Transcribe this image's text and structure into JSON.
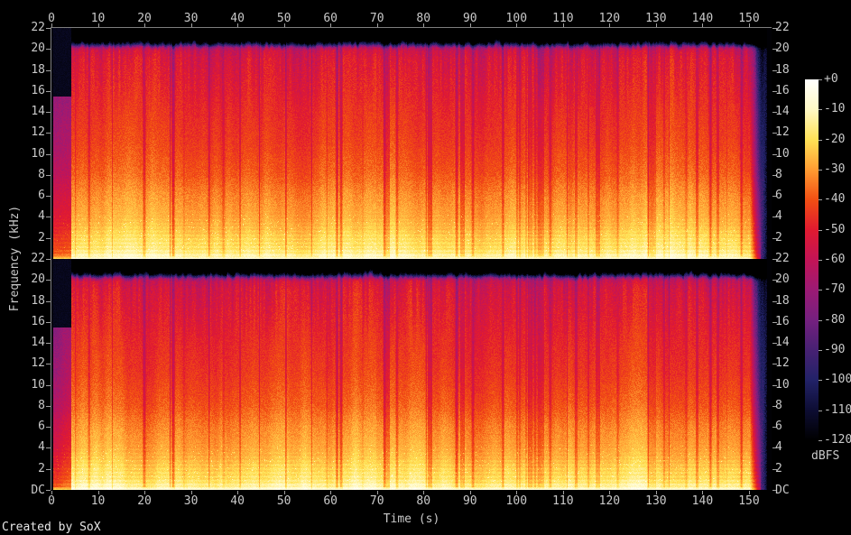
{
  "meta": {
    "credit": "Created by SoX"
  },
  "colors": {
    "background": "#000000",
    "axis_line": "#7e7e7e",
    "tick": "#a0a0a0",
    "label_text": "#c9c9c9",
    "credit_text": "#e8e8e8"
  },
  "axes": {
    "time": {
      "label": "Time (s)",
      "ticks": [
        "0",
        "10",
        "20",
        "30",
        "40",
        "50",
        "60",
        "70",
        "80",
        "90",
        "100",
        "110",
        "120",
        "130",
        "140",
        "150"
      ]
    },
    "frequency": {
      "label": "Frequency (kHz)",
      "ticks": [
        "22",
        "20",
        "18",
        "16",
        "14",
        "12",
        "10",
        "8",
        "6",
        "4",
        "2"
      ],
      "dc_label": "DC"
    }
  },
  "colorbar": {
    "label": "dBFS",
    "ticks": [
      "+0",
      "-10",
      "-20",
      "-30",
      "-40",
      "-50",
      "-60",
      "-70",
      "-80",
      "-90",
      "-100",
      "-110",
      "-120"
    ],
    "stops": [
      {
        "db": 0,
        "hex": "#ffffff"
      },
      {
        "db": -10,
        "hex": "#fff9c5"
      },
      {
        "db": -20,
        "hex": "#ffe256"
      },
      {
        "db": -30,
        "hex": "#ff9c32"
      },
      {
        "db": -40,
        "hex": "#f24f13"
      },
      {
        "db": -50,
        "hex": "#e11a30"
      },
      {
        "db": -60,
        "hex": "#c31456"
      },
      {
        "db": -70,
        "hex": "#9c1a74"
      },
      {
        "db": -80,
        "hex": "#75207f"
      },
      {
        "db": -90,
        "hex": "#472173"
      },
      {
        "db": -100,
        "hex": "#222268"
      },
      {
        "db": -110,
        "hex": "#0d0d33"
      },
      {
        "db": -120,
        "hex": "#000000"
      }
    ]
  },
  "chart_data": {
    "type": "heatmap",
    "subtype": "audio-spectrogram",
    "title": "",
    "xlabel": "Time (s)",
    "ylabel": "Frequency (kHz)",
    "zlabel": "dBFS",
    "x_range_s": [
      0,
      154.8
    ],
    "x_ticks_s": [
      0,
      10,
      20,
      30,
      40,
      50,
      60,
      70,
      80,
      90,
      100,
      110,
      120,
      130,
      140,
      150
    ],
    "y_range_khz": [
      0,
      22
    ],
    "y_ticks_khz": [
      22,
      20,
      18,
      16,
      14,
      12,
      10,
      8,
      6,
      4,
      2,
      0
    ],
    "z_range_dbfs": [
      -120,
      0
    ],
    "z_ticks_dbfs": [
      0,
      -10,
      -20,
      -30,
      -40,
      -50,
      -60,
      -70,
      -80,
      -90,
      -100,
      -110,
      -120
    ],
    "channels": [
      "left",
      "right"
    ],
    "legend_position": "right-colorbar",
    "grid": false,
    "avg_level_by_freq_dbfs": [
      [
        0,
        -7
      ],
      [
        0.4,
        -13
      ],
      [
        1,
        -18
      ],
      [
        2,
        -21
      ],
      [
        3,
        -25
      ],
      [
        4,
        -28
      ],
      [
        6,
        -32
      ],
      [
        8,
        -38
      ],
      [
        11,
        -43
      ],
      [
        14,
        -46
      ],
      [
        17,
        -50
      ],
      [
        19,
        -53
      ],
      [
        19.8,
        -57
      ],
      [
        20.1,
        -63
      ],
      [
        20.5,
        -88
      ],
      [
        21,
        -106
      ],
      [
        21.6,
        -114
      ],
      [
        22,
        -117
      ]
    ],
    "events": {
      "pre_roll_s": 0.3,
      "intro": {
        "end_s": 4.25,
        "atten_db": 23,
        "cutoff_khz": 15.45
      },
      "content_top_khz": 20.05,
      "strong_gaps": [
        [
          26.2,
          0.5,
          18
        ],
        [
          62.3,
          0.45,
          16
        ]
      ],
      "quiet_zones": [
        [
          69.8,
          72.8,
          8,
          1
        ],
        [
          81.0,
          81.8,
          10,
          0
        ],
        [
          88.0,
          88.8,
          9,
          0
        ],
        [
          100.0,
          106.0,
          6,
          1
        ],
        [
          112.5,
          113.2,
          8,
          0
        ],
        [
          117.0,
          118.0,
          8,
          0
        ],
        [
          128.0,
          133.0,
          6,
          1
        ],
        [
          138.5,
          139.2,
          9,
          0
        ],
        [
          143.0,
          143.6,
          8,
          0
        ]
      ],
      "thin_gap_mean_interval_s": 4.5,
      "fade_out": {
        "start_s": 150.2,
        "full_s": 152.6,
        "end_s": 153.9
      }
    }
  }
}
